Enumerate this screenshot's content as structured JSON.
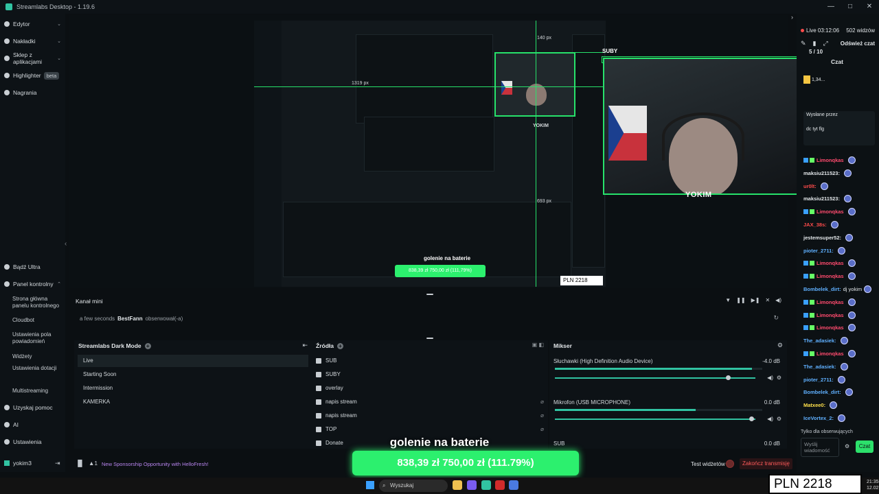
{
  "app": {
    "title": "Streamlabs Desktop - 1.19.6",
    "win_controls": [
      "—",
      "□",
      "✕"
    ]
  },
  "sidebar": {
    "top_items": [
      {
        "label": "Edytor",
        "chevron": "⌄"
      },
      {
        "label": "Nakładki",
        "chevron": "⌄"
      },
      {
        "label": "Sklep z aplikacjami",
        "chevron": "⌄"
      },
      {
        "label": "Highlighter",
        "badge": "beta"
      },
      {
        "label": "Nagrania"
      }
    ],
    "ultra": "Bądź Ultra",
    "panel": "Panel kontrolny",
    "panel_chevron": "⌃",
    "panel_sub": [
      "Strona główna panelu kontrolnego",
      "Cloudbot",
      "Ustawienia pola powiadomień",
      "Widżety",
      "Ustawienia dotacji",
      "Multistreaming"
    ],
    "help": "Uzyskaj pomoc",
    "ai": "AI",
    "settings": "Ustawienia"
  },
  "preview": {
    "suby_label": "SUBY",
    "yokim_label": "YOKIM",
    "mini_yokim": "YOKIM",
    "px1": "140 px",
    "px2": "1319 px",
    "px3": "693 px",
    "mini_goal_title": "golenie na baterie",
    "mini_goal_amount": "838,39 zł   750,00 zł (111,79%)",
    "pln_mini": "PLN 2218"
  },
  "mini_channel": {
    "title": "Kanał mini",
    "time": "a few seconds",
    "user": "BestFann",
    "action": "obserwował(-a)"
  },
  "scenes": {
    "title": "Streamlabs Dark Mode",
    "items": [
      "Live",
      "Starting Soon",
      "Intermission",
      "KAMERKA"
    ]
  },
  "sources": {
    "title": "Źródła",
    "items": [
      "SUB",
      "SUBY",
      "overlay",
      "napis stream",
      "napis stream",
      "TOP",
      "Donate"
    ]
  },
  "mixer": {
    "title": "Mikser",
    "channels": [
      {
        "name": "Słuchawki (High Definition Audio Device)",
        "db": "-4.0 dB",
        "level": 0.95,
        "volume": 0.88
      },
      {
        "name": "Mikrofon (USB MICROPHONE)",
        "db": "0.0 dB",
        "level": 0.68,
        "volume": 1.0
      },
      {
        "name": "SUB",
        "db": "0.0 dB",
        "level": 0,
        "volume": 1.0
      }
    ]
  },
  "goal": {
    "title": "golenie na baterie",
    "amount": "838,39 zł   750,00 zł (111.79%)"
  },
  "footer": {
    "user": "yokim3",
    "exit_icon": "⇥",
    "alert_count": "1",
    "news": "New Sponsorship Opportunity with HelloFresh!",
    "test_widgets": "Test widżetów",
    "stop_stream": "Zakończ transmisję"
  },
  "chat": {
    "live": "Live 03:12:06",
    "viewers": "502 widzów",
    "refresh": "Odśwież czat",
    "count": "5 / 10",
    "tab": "Czat",
    "pinned_user": "1,34...",
    "wyslane": "Wysłane przez",
    "wyslane_msg": "dc tyt flg",
    "messages": [
      {
        "user": "Limonqkas",
        "text": "",
        "color": "#ff4b6e"
      },
      {
        "user": "maksiu211523:",
        "text": "",
        "color": "#e3e7ea"
      },
      {
        "user": "ur0lt:",
        "text": "",
        "color": "#ff4b4b"
      },
      {
        "user": "maksiu211523:",
        "text": "",
        "color": "#e3e7ea"
      },
      {
        "user": "Limonqkas",
        "text": "",
        "color": "#ff4b6e"
      },
      {
        "user": "JAX_38s:",
        "text": "",
        "color": "#ff4b4b"
      },
      {
        "user": "jestemsuper52:",
        "text": "",
        "color": "#e3e7ea"
      },
      {
        "user": "pioter_2711:",
        "text": "",
        "color": "#5fb0ff"
      },
      {
        "user": "Limonqkas",
        "text": "",
        "color": "#ff4b6e"
      },
      {
        "user": "Limonqkas",
        "text": "",
        "color": "#ff4b6e"
      },
      {
        "user": "Bombelek_dirt:",
        "text": "dj yokim",
        "color": "#5fb0ff"
      },
      {
        "user": "Limonqkas",
        "text": "",
        "color": "#ff4b6e"
      },
      {
        "user": "Limonqkas",
        "text": "",
        "color": "#ff4b6e"
      },
      {
        "user": "Limonqkas",
        "text": "",
        "color": "#ff4b6e"
      },
      {
        "user": "The_adasiek:",
        "text": "",
        "color": "#5fb0ff"
      },
      {
        "user": "Limonqkas",
        "text": "",
        "color": "#ff4b6e"
      },
      {
        "user": "The_adasiek:",
        "text": "",
        "color": "#5fb0ff"
      },
      {
        "user": "pioter_2711:",
        "text": "",
        "color": "#5fb0ff"
      },
      {
        "user": "Bombelek_dirt:",
        "text": "",
        "color": "#5fb0ff"
      },
      {
        "user": "Matxee0:",
        "text": "",
        "color": "#ffe14b"
      },
      {
        "user": "IceVortex_2:",
        "text": "",
        "color": "#5fb0ff"
      }
    ],
    "followers": "Tylko dla obserwujących",
    "input_placeholder": "Wyślij wiadomość",
    "send": "Czat"
  },
  "taskbar": {
    "search": "Wyszukaj",
    "time": "21:35",
    "date": "12.02.2026"
  },
  "overlay_box": "PLN 2218",
  "colors": {
    "accent": "#31c3a2",
    "goal_green": "#2cf06e",
    "stop_red": "#ff5b5b"
  }
}
